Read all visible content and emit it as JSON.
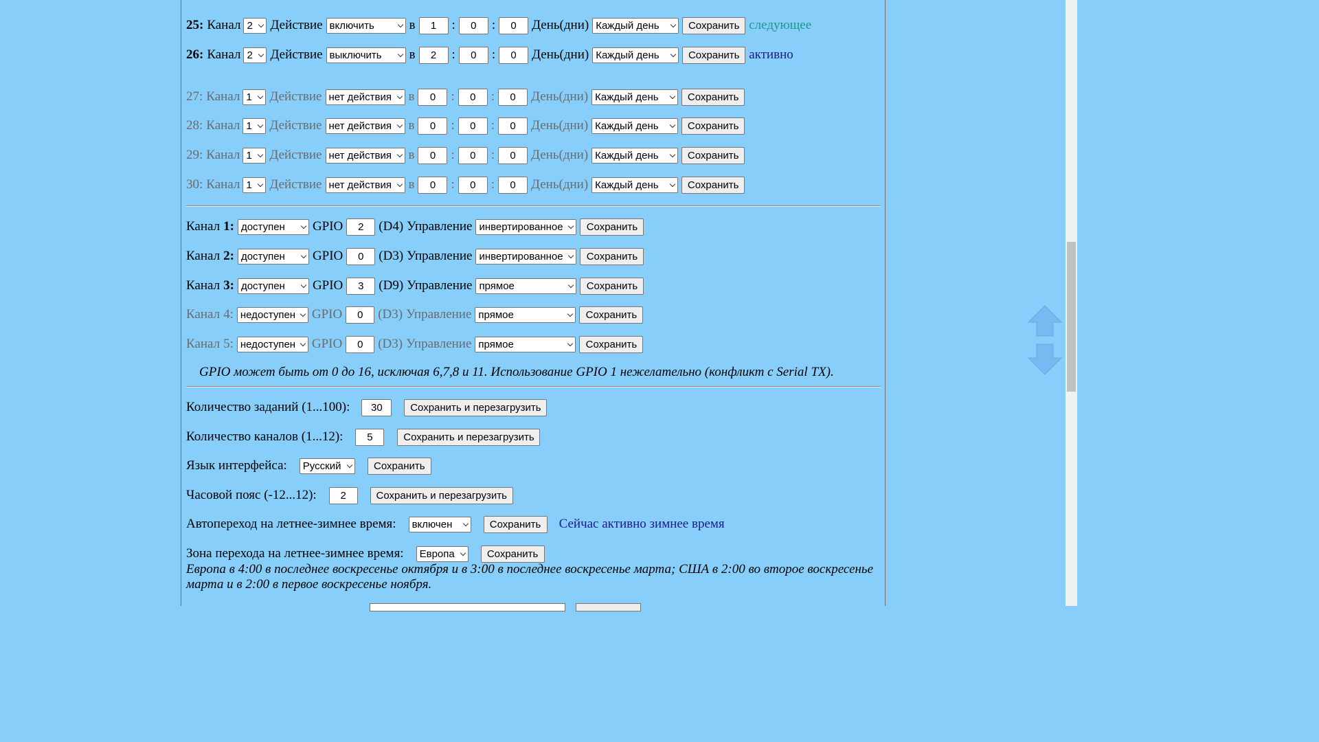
{
  "tasks": [
    {
      "num": "25:",
      "channel": "2",
      "action": "включить",
      "h": "1",
      "m": "0",
      "s": "0",
      "days": "Каждый день",
      "status": "следующее",
      "status_type": "next",
      "bold": true
    },
    {
      "num": "26:",
      "channel": "2",
      "action": "выключить",
      "h": "2",
      "m": "0",
      "s": "0",
      "days": "Каждый день",
      "status": "активно",
      "status_type": "active",
      "bold": true
    },
    {
      "num": "27:",
      "channel": "1",
      "action": "нет действия",
      "h": "0",
      "m": "0",
      "s": "0",
      "days": "Каждый день",
      "status": "",
      "bold": false
    },
    {
      "num": "28:",
      "channel": "1",
      "action": "нет действия",
      "h": "0",
      "m": "0",
      "s": "0",
      "days": "Каждый день",
      "status": "",
      "bold": false
    },
    {
      "num": "29:",
      "channel": "1",
      "action": "нет действия",
      "h": "0",
      "m": "0",
      "s": "0",
      "days": "Каждый день",
      "status": "",
      "bold": false
    },
    {
      "num": "30:",
      "channel": "1",
      "action": "нет действия",
      "h": "0",
      "m": "0",
      "s": "0",
      "days": "Каждый день",
      "status": "",
      "bold": false
    }
  ],
  "task_labels": {
    "channel": "Канал",
    "action": "Действие",
    "at": "в",
    "colon": ":",
    "days": "День(дни)",
    "save": "Сохранить"
  },
  "channels": [
    {
      "label": "Канал",
      "num": "1:",
      "state": "доступен",
      "gpio": "2",
      "pin": "(D4)",
      "control": "инвертированное",
      "enabled": true
    },
    {
      "label": "Канал",
      "num": "2:",
      "state": "доступен",
      "gpio": "0",
      "pin": "(D3)",
      "control": "инвертированное",
      "enabled": true
    },
    {
      "label": "Канал",
      "num": "3:",
      "state": "доступен",
      "gpio": "3",
      "pin": "(D9)",
      "control": "прямое",
      "enabled": true
    },
    {
      "label": "Канал",
      "num": "4:",
      "state": "недоступен",
      "gpio": "0",
      "pin": "(D3)",
      "control": "прямое",
      "enabled": false
    },
    {
      "label": "Канал",
      "num": "5:",
      "state": "недоступен",
      "gpio": "0",
      "pin": "(D3)",
      "control": "прямое",
      "enabled": false
    }
  ],
  "channel_labels": {
    "gpio": "GPIO",
    "control": "Управление",
    "save": "Сохранить"
  },
  "gpio_note": "GPIO может быть от 0 до 16, исключая 6,7,8 и 11. Использование GPIO 1 нежелательно (конфликт с Serial TX).",
  "settings": {
    "task_count": {
      "label": "Количество заданий (1...100):",
      "value": "30",
      "button": "Сохранить и перезагрузить"
    },
    "channel_count": {
      "label": "Количество каналов (1...12):",
      "value": "5",
      "button": "Сохранить и перезагрузить"
    },
    "language": {
      "label": "Язык интерфейса:",
      "value": "Русский",
      "button": "Сохранить"
    },
    "timezone": {
      "label": "Часовой пояс (-12...12):",
      "value": "2",
      "button": "Сохранить и перезагрузить"
    },
    "dst_auto": {
      "label": "Автопереход на летнее-зимнее время:",
      "value": "включен",
      "button": "Сохранить",
      "status": "Сейчас активно зимнее время"
    },
    "dst_zone": {
      "label": "Зона перехода на летнее-зимнее время:",
      "value": "Европа",
      "button": "Сохранить"
    },
    "dst_note": "Европа в 4:00 в последнее воскресенье октября и в 3:00 в последнее воскресенье марта; США в 2:00 во второе воскресенье марта и в 2:00 в первое воскресенье ноября."
  },
  "colors": {
    "background": "#87cefa",
    "next_status": "#1a9a8a",
    "active_status": "#1a1a8c",
    "disabled_text": "#6b6b6b"
  }
}
